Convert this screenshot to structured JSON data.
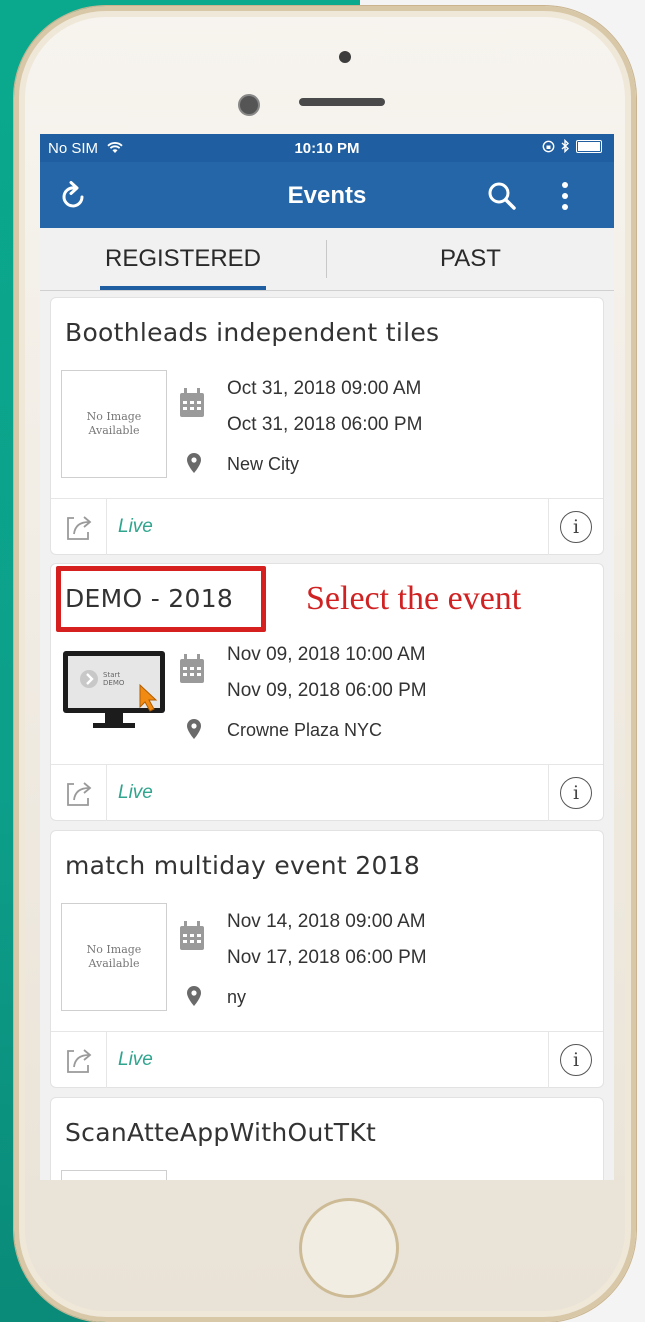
{
  "status_bar": {
    "carrier": "No SIM",
    "time": "10:10 PM"
  },
  "app_bar": {
    "title": "Events",
    "refresh_icon": "refresh-icon",
    "search_icon": "search-icon",
    "more_icon": "more-vert-icon"
  },
  "tabs": [
    {
      "label": "REGISTERED",
      "active": true
    },
    {
      "label": "PAST",
      "active": false
    }
  ],
  "events": [
    {
      "title": "Boothleads independent tiles",
      "image": "No Image Available",
      "start": "Oct 31, 2018 09:00 AM",
      "end": "Oct 31, 2018 06:00 PM",
      "location": "New City",
      "status": "Live"
    },
    {
      "title": "DEMO - 2018",
      "image": "Start DEMO",
      "start": "Nov 09, 2018 10:00 AM",
      "end": "Nov 09, 2018 06:00 PM",
      "location": "Crowne Plaza NYC",
      "status": "Live"
    },
    {
      "title": "match multiday event 2018",
      "image": "No Image Available",
      "start": "Nov 14, 2018 09:00 AM",
      "end": "Nov 17, 2018 06:00 PM",
      "location": "ny",
      "status": "Live"
    },
    {
      "title": "ScanAtteAppWithOutTKt"
    }
  ],
  "annotation": "Select the event",
  "colors": {
    "app_bar": "#2466a8",
    "accent": "#1f5ea0",
    "live": "#2fa58e",
    "annotation": "#d02222",
    "background": "#0aa98d"
  }
}
